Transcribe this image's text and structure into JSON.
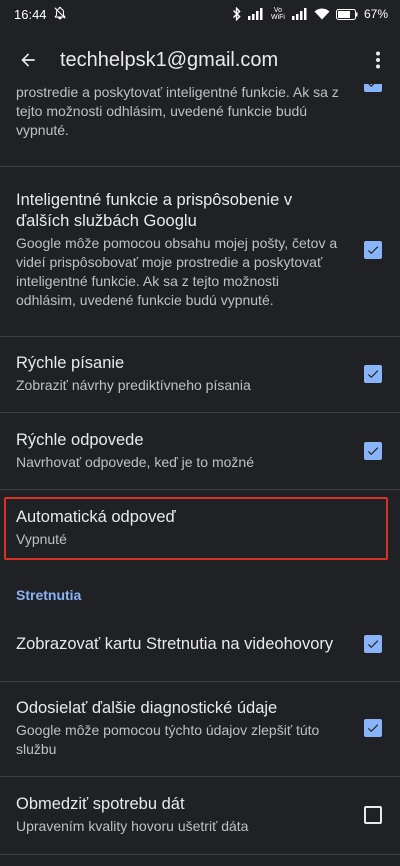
{
  "status_bar": {
    "time": "16:44",
    "vowifi": "Vo WiFi",
    "battery": "67"
  },
  "app_bar": {
    "account": "techhelpsk1@gmail.com"
  },
  "items": [
    {
      "title": "",
      "subtitle": "prostredie a poskytovať inteligentné funkcie. Ak sa z tejto možnosti odhlásim, uvedené funkcie budú vypnuté.",
      "checked": true
    },
    {
      "title": "Inteligentné funkcie a prispôsobenie v ďalších službách Googlu",
      "subtitle": "Google môže pomocou obsahu mojej pošty, četov a videí prispôsobovať moje prostredie a poskytovať inteligentné funkcie. Ak sa z tejto možnosti odhlásim, uvedené funkcie budú vypnuté.",
      "checked": true
    },
    {
      "title": "Rýchle písanie",
      "subtitle": "Zobraziť návrhy prediktívneho písania",
      "checked": true
    },
    {
      "title": "Rýchle odpovede",
      "subtitle": "Navrhovať odpovede, keď je to možné",
      "checked": true
    },
    {
      "title": "Automatická odpoveď",
      "subtitle": "Vypnuté"
    }
  ],
  "section": {
    "header": "Stretnutia",
    "items": [
      {
        "title": "Zobrazovať kartu Stretnutia na videohovory",
        "subtitle": "",
        "checked": true
      },
      {
        "title": "Odosielať ďalšie diagnostické údaje",
        "subtitle": "Google môže pomocou týchto údajov zlepšiť túto službu",
        "checked": true
      },
      {
        "title": "Obmedziť spotrebu dát",
        "subtitle": "Upravením kvality hovoru ušetriť dáta",
        "checked": false
      }
    ]
  },
  "colors": {
    "background": "#202124",
    "accent": "#8ab4f8",
    "highlight": "#d93025"
  }
}
